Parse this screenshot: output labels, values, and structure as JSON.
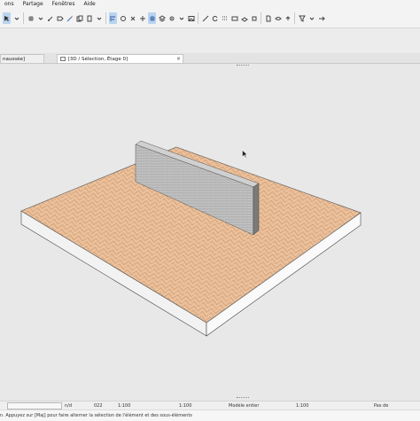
{
  "menubar": {
    "items": [
      {
        "label": "ons"
      },
      {
        "label": "Partage"
      },
      {
        "label": "Fenêtres"
      },
      {
        "label": "Aide"
      }
    ]
  },
  "tabs": {
    "left_label": "naussée]",
    "active_label": "[3D / Sélection, Étage 0]",
    "close_glyph": "×"
  },
  "status": {
    "field1": "n/d",
    "field2": "022",
    "scale": "1:100",
    "scale2": "1:100",
    "model": "Modèle entier",
    "field5": "1:100",
    "last": "Pas de"
  },
  "message": {
    "text": "n. Appuyez sur [Maj] pour faire alterner la sélection de l'élément et des sous-éléments"
  },
  "colors": {
    "accent": "#b9d4ef",
    "floor": "#e9b891",
    "wall": "#bdbdbd",
    "viewport": "#e8e8e8"
  }
}
